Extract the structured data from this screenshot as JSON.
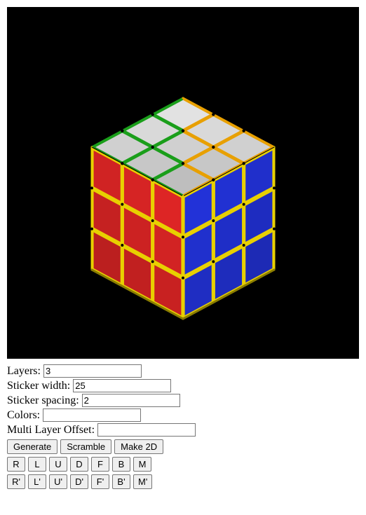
{
  "fields": {
    "layers": {
      "label": "Layers:",
      "value": "3"
    },
    "sticker_width": {
      "label": "Sticker width:",
      "value": "25"
    },
    "sticker_spacing": {
      "label": "Sticker spacing:",
      "value": "2"
    },
    "colors": {
      "label": "Colors:",
      "value": ""
    },
    "multi_layer_offset": {
      "label": "Multi Layer Offset:",
      "value": ""
    }
  },
  "action_buttons": {
    "generate": "Generate",
    "scramble": "Scramble",
    "make2d": "Make 2D"
  },
  "move_buttons_row1": [
    "R",
    "L",
    "U",
    "D",
    "F",
    "B",
    "M"
  ],
  "move_buttons_row2": [
    "R'",
    "L'",
    "U'",
    "D'",
    "F'",
    "B'",
    "M'"
  ],
  "cube": {
    "layers": 3,
    "face_colors": {
      "top": "#d7d7d7",
      "left": "#d22323",
      "right": "#2232d8"
    },
    "edge_colors": {
      "top_left": "#1a9e1a",
      "top_right": "#e8a000",
      "vertical": "#e8d000"
    },
    "body_color": "#000000"
  }
}
